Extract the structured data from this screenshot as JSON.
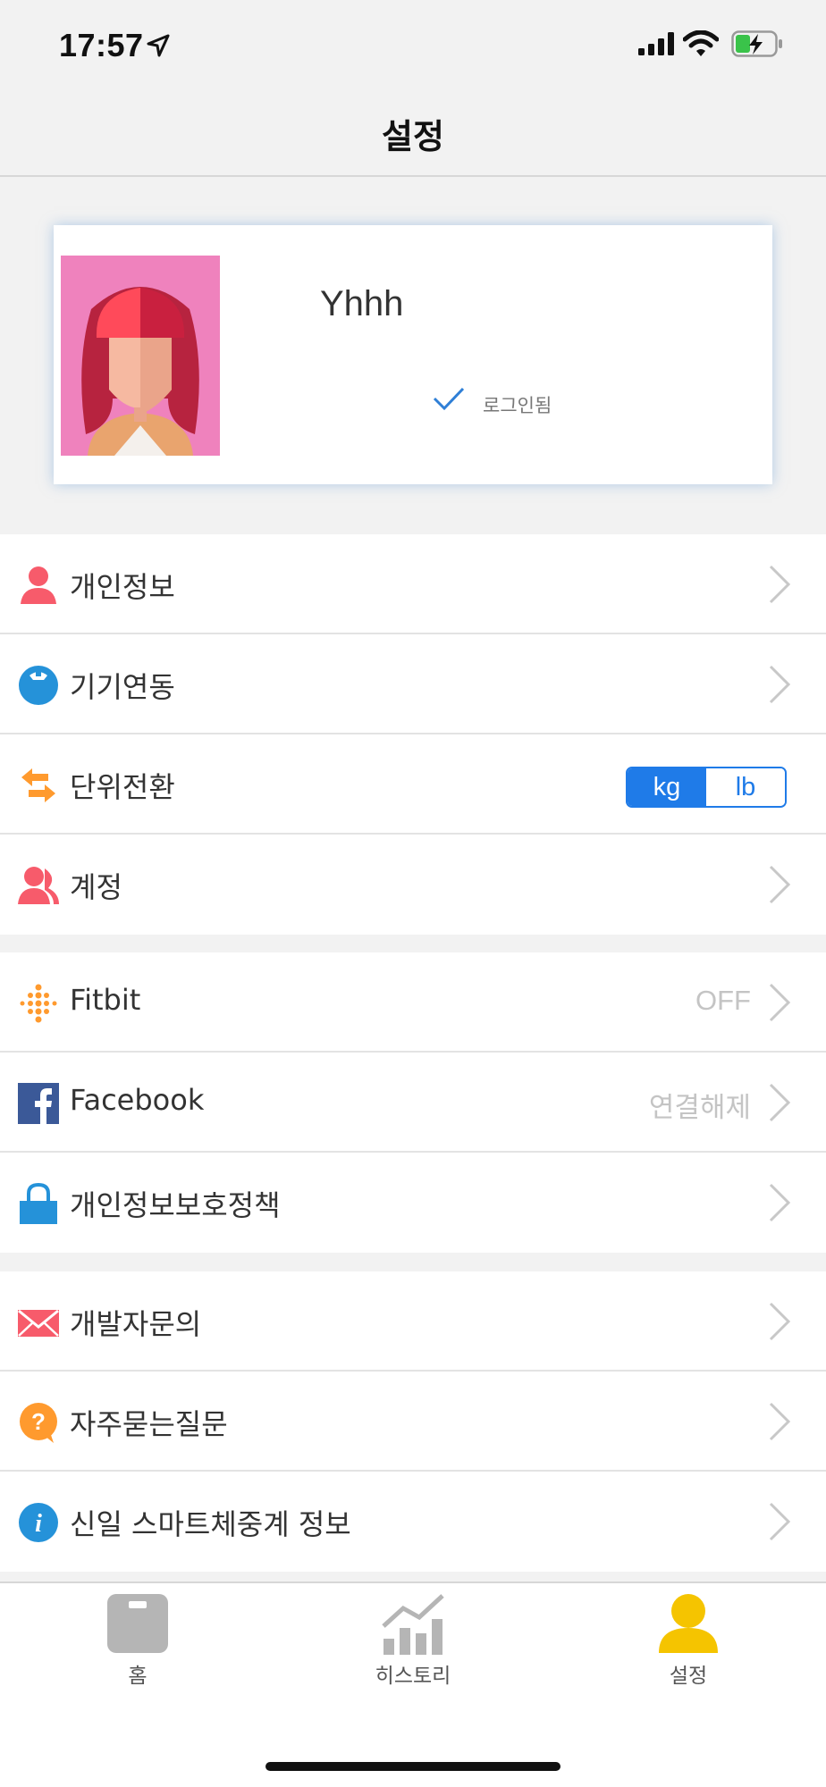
{
  "status_bar": {
    "time": "17:57"
  },
  "nav": {
    "title": "설정"
  },
  "profile": {
    "name": "Yhhh",
    "login_status": "로그인됨"
  },
  "groups": [
    [
      {
        "icon": "person-icon",
        "label": "개인정보"
      },
      {
        "icon": "scale-icon",
        "label": "기기연동"
      },
      {
        "icon": "swap-arrows-icon",
        "label": "단위전환"
      },
      {
        "icon": "account-icon",
        "label": "계정"
      }
    ],
    [
      {
        "icon": "fitbit-icon",
        "label": "Fitbit",
        "value": "OFF"
      },
      {
        "icon": "facebook-icon",
        "label": "Facebook",
        "value": "연결해제"
      },
      {
        "icon": "lock-icon",
        "label": "개인정보보호정책"
      }
    ],
    [
      {
        "icon": "mail-icon",
        "label": "개발자문의"
      },
      {
        "icon": "question-icon",
        "label": "자주묻는질문"
      },
      {
        "icon": "info-icon",
        "label": "신일 스마트체중계 정보"
      }
    ]
  ],
  "unit_toggle": {
    "options": [
      "kg",
      "lb"
    ],
    "selected": "kg"
  },
  "tabs": [
    {
      "icon": "scale-home-icon",
      "label": "홈"
    },
    {
      "icon": "history-chart-icon",
      "label": "히스토리"
    },
    {
      "icon": "settings-person-icon",
      "label": "설정",
      "active": true
    }
  ],
  "colors": {
    "accent": "#1f7be8",
    "active_tab": "#f5c400",
    "inactive_tab": "#b5b5b5",
    "avatar_bg": "#ef82bd"
  }
}
